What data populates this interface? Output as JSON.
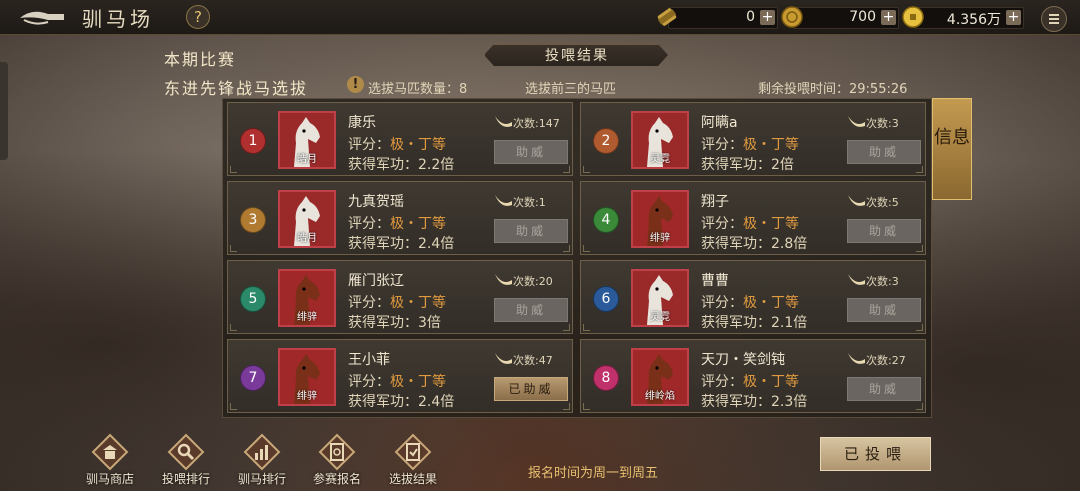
{
  "header": {
    "title": "驯马场",
    "help": "?",
    "resources": [
      {
        "icon": "scroll-icon",
        "value": "0"
      },
      {
        "icon": "copper-coin-icon",
        "value": "700"
      },
      {
        "icon": "gold-coin-icon",
        "value": "4.356万"
      }
    ],
    "menu_icon": "menu-icon"
  },
  "event": {
    "season_label": "本期比赛",
    "name": "东进先锋战马选拔",
    "banner": "投喂结果",
    "selected_count": "选拔马匹数量：8",
    "top_three": "选拔前三的马匹",
    "remaining": "剩余投喂时间：29:55:26"
  },
  "horses": [
    {
      "rank": "1",
      "rank_color": "#b03030",
      "name": "康乐",
      "rating_label": "评分：",
      "grade": "极・丁等",
      "merit": "获得军功：2.2倍",
      "count": "次数:147",
      "breed": "皓月",
      "coat": "white",
      "button": "助威",
      "done": false
    },
    {
      "rank": "2",
      "rank_color": "#b05a30",
      "name": "阿瞒a",
      "rating_label": "评分：",
      "grade": "极・丁等",
      "merit": "获得军功：2倍",
      "count": "次数:3",
      "breed": "灵霓",
      "coat": "white",
      "button": "助威",
      "done": false
    },
    {
      "rank": "3",
      "rank_color": "#b07a30",
      "name": "九真贺瑶",
      "rating_label": "评分：",
      "grade": "极・丁等",
      "merit": "获得军功：2.4倍",
      "count": "次数:1",
      "breed": "皓月",
      "coat": "white",
      "button": "助威",
      "done": false
    },
    {
      "rank": "4",
      "rank_color": "#3a8a3a",
      "name": "翔子",
      "rating_label": "评分：",
      "grade": "极・丁等",
      "merit": "获得军功：2.8倍",
      "count": "次数:5",
      "breed": "绯骍",
      "coat": "brown",
      "button": "助威",
      "done": false
    },
    {
      "rank": "5",
      "rank_color": "#2a8a6a",
      "name": "雁门张辽",
      "rating_label": "评分：",
      "grade": "极・丁等",
      "merit": "获得军功：3倍",
      "count": "次数:20",
      "breed": "绯骍",
      "coat": "brown",
      "button": "助威",
      "done": false
    },
    {
      "rank": "6",
      "rank_color": "#2a5a9a",
      "name": "曹曹",
      "rating_label": "评分：",
      "grade": "极・丁等",
      "merit": "获得军功：2.1倍",
      "count": "次数:3",
      "breed": "灵霓",
      "coat": "white",
      "button": "助威",
      "done": false
    },
    {
      "rank": "7",
      "rank_color": "#7a3a9a",
      "name": "王小菲",
      "rating_label": "评分：",
      "grade": "极・丁等",
      "merit": "获得军功：2.4倍",
      "count": "次数:47",
      "breed": "绯骍",
      "coat": "brown",
      "button": "已助威",
      "done": true
    },
    {
      "rank": "8",
      "rank_color": "#c0306a",
      "name": "天刀・笑剑钝",
      "rating_label": "评分：",
      "grade": "极・丁等",
      "merit": "获得军功：2.3倍",
      "count": "次数:27",
      "breed": "绯岭焰",
      "coat": "brown",
      "button": "助威",
      "done": false
    }
  ],
  "side_tab": "信息",
  "nav": [
    {
      "label": "驯马商店",
      "icon": "shop-icon"
    },
    {
      "label": "投喂排行",
      "icon": "magnifier-icon"
    },
    {
      "label": "驯马排行",
      "icon": "bar-chart-icon"
    },
    {
      "label": "参赛报名",
      "icon": "clipboard-icon"
    },
    {
      "label": "选拔结果",
      "icon": "result-list-icon"
    }
  ],
  "footer": {
    "registration_time": "报名时间为周一到周五",
    "fed_button": "已投喂"
  }
}
